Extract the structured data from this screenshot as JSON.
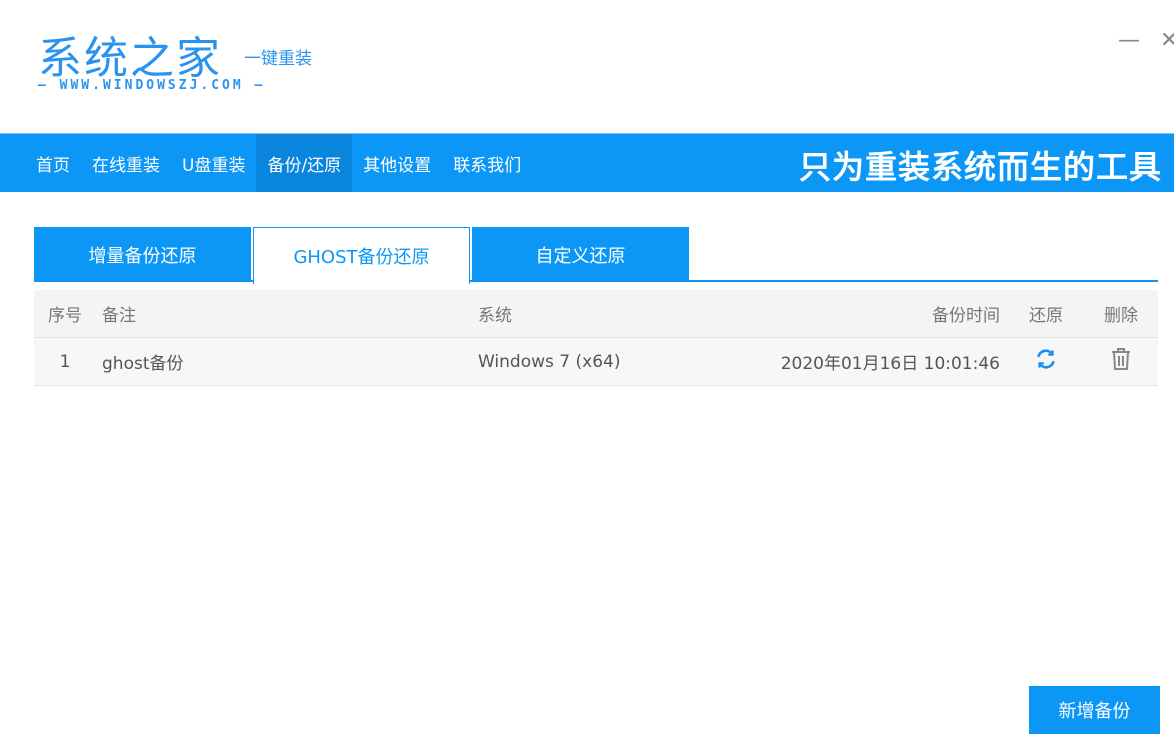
{
  "logo": {
    "title": "系统之家",
    "subtitle": "一键重装",
    "url": "— WWW.WINDOWSZJ.COM —"
  },
  "window": {
    "minimize": "—",
    "close": "✕"
  },
  "nav": {
    "items": [
      "首页",
      "在线重装",
      "U盘重装",
      "备份/还原",
      "其他设置",
      "联系我们"
    ],
    "active": 3,
    "slogan": "只为重装系统而生的工具"
  },
  "tabs": [
    "增量备份还原",
    "GHOST备份还原",
    "自定义还原"
  ],
  "table": {
    "headers": [
      "序号",
      "备注",
      "系统",
      "备份时间",
      "还原",
      "删除"
    ],
    "rows": [
      {
        "index": "1",
        "note": "ghost备份",
        "system": "Windows 7 (x64)",
        "time": "2020年01月16日 10:01:46"
      }
    ]
  },
  "actions": {
    "new_backup": "新增备份"
  },
  "colors": {
    "accent": "#0c97f6"
  }
}
